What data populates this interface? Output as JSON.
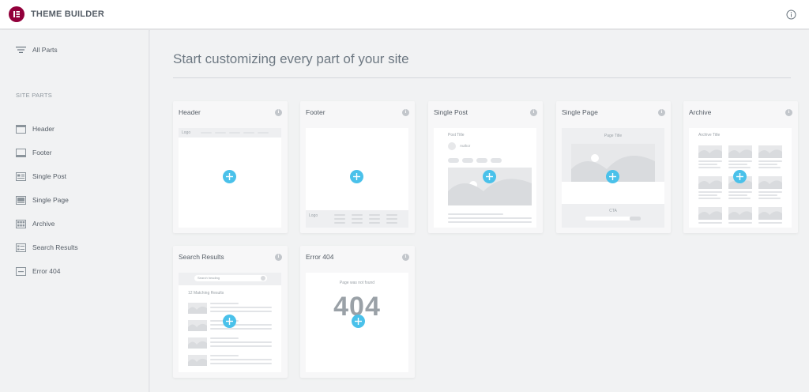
{
  "app": {
    "title": "THEME BUILDER"
  },
  "sidebar": {
    "all_parts_label": "All Parts",
    "section_title": "SITE PARTS",
    "items": [
      {
        "label": "Header",
        "icon": "header-layout-icon"
      },
      {
        "label": "Footer",
        "icon": "footer-layout-icon"
      },
      {
        "label": "Single Post",
        "icon": "single-post-icon"
      },
      {
        "label": "Single Page",
        "icon": "single-page-icon"
      },
      {
        "label": "Archive",
        "icon": "archive-icon"
      },
      {
        "label": "Search Results",
        "icon": "search-results-icon"
      },
      {
        "label": "Error 404",
        "icon": "error-404-icon"
      }
    ]
  },
  "main": {
    "heading": "Start customizing every part of your site",
    "cards": [
      {
        "title": "Header",
        "preview_text": {
          "logo": "Logo"
        }
      },
      {
        "title": "Footer",
        "preview_text": {
          "logo": "Logo"
        }
      },
      {
        "title": "Single Post",
        "preview_text": {
          "post_title": "Post Title",
          "author": "Author"
        }
      },
      {
        "title": "Single Page",
        "preview_text": {
          "page_title": "Page Title",
          "cta": "CTA"
        }
      },
      {
        "title": "Archive",
        "preview_text": {
          "archive_title": "Archive Title"
        }
      },
      {
        "title": "Search Results",
        "preview_text": {
          "search_placeholder": "Search heading",
          "results": "12 Matching Results"
        }
      },
      {
        "title": "Error 404",
        "preview_text": {
          "not_found": "Page was not found",
          "code": "404"
        }
      }
    ]
  },
  "colors": {
    "brand": "#92003b",
    "accent": "#4ac1ea",
    "text": "#6d7882"
  }
}
